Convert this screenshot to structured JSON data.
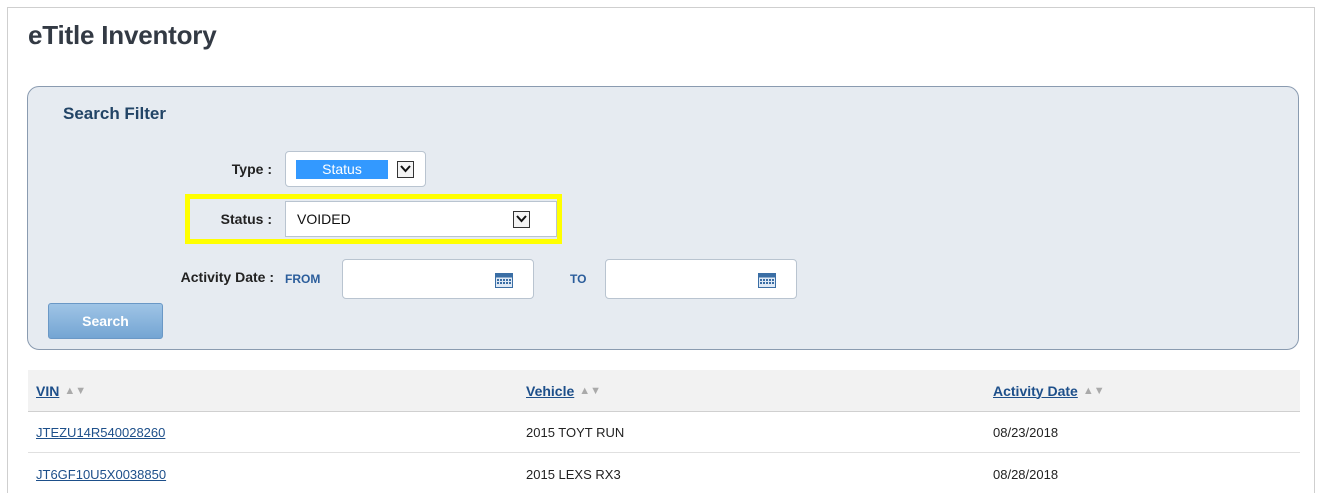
{
  "page": {
    "title": "eTitle Inventory"
  },
  "filter": {
    "title": "Search Filter",
    "type_label": "Type :",
    "type_value": "Status",
    "status_label": "Status :",
    "status_value": "VOIDED",
    "activity_label": "Activity Date :",
    "from_label": "FROM",
    "to_label": "TO",
    "from_value": "",
    "to_value": "",
    "search_label": "Search",
    "highlight_color": "#ffff00"
  },
  "table": {
    "columns": [
      "VIN",
      "Vehicle",
      "Activity Date"
    ],
    "rows": [
      {
        "vin": "JTEZU14R540028260",
        "vehicle": "2015 TOYT RUN",
        "date": "08/23/2018"
      },
      {
        "vin": "JT6GF10U5X0038850",
        "vehicle": "2015 LEXS RX3",
        "date": "08/28/2018"
      }
    ]
  },
  "icons": [
    "chevron-down-icon",
    "calendar-icon",
    "sort-icon"
  ],
  "colors": {
    "accent": "#3399ff",
    "link": "#1d4f8a",
    "panel": "#e6ebf1"
  }
}
